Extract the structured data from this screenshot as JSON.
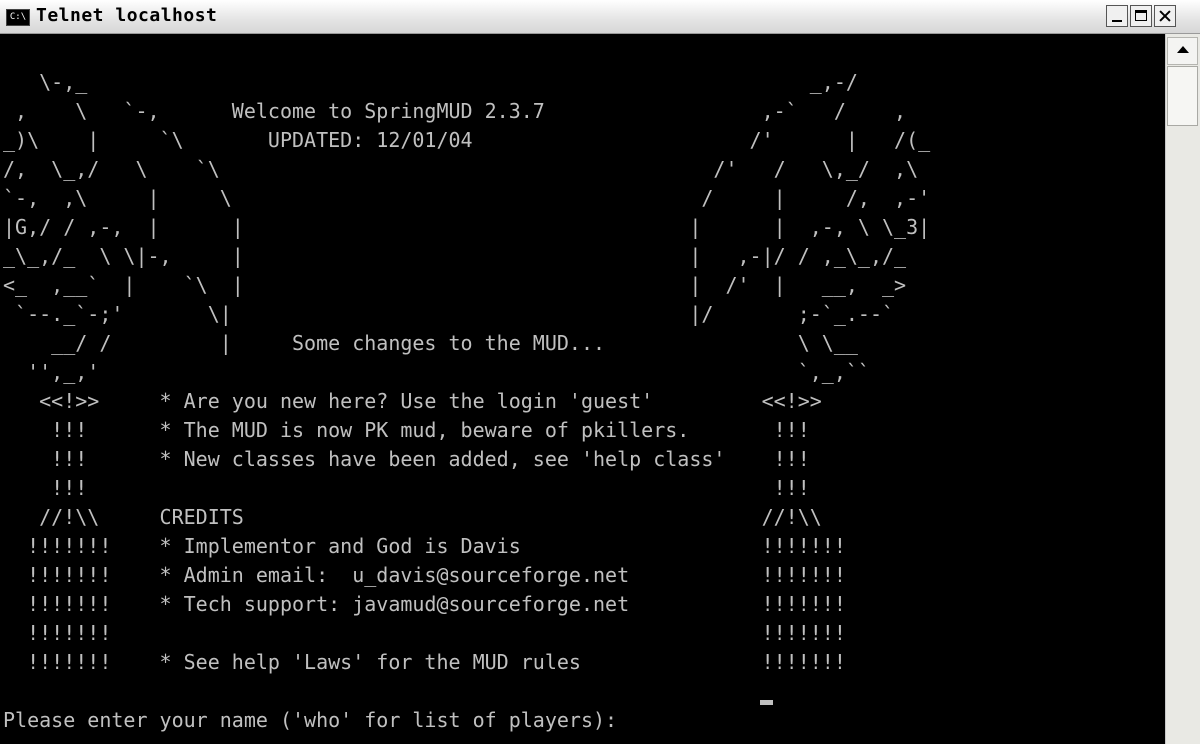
{
  "window": {
    "icon_text": "C:\\",
    "title": "Telnet localhost"
  },
  "console": {
    "lines": [
      "   \\-,_                                                            _,-/",
      " ,    \\   `-,      Welcome to SpringMUD 2.3.7                  ,-`   /    ,",
      "_)\\    |     `\\       UPDATED: 12/01/04                       /'      |   /(_",
      "/,  \\_,/   \\    `\\                                         /'   /   \\,_/  ,\\",
      "`-,  ,\\     |     \\                                       /     |     /,  ,-'",
      "|G,/ / ,-,  |      |                                     |      |  ,-, \\ \\_3|",
      "_\\_,/_  \\ \\|-,     |                                     |   ,-|/ / ,_\\_,/_",
      "<_  ,__`  |    `\\  |                                     |  /'  |   __,  _>",
      " `--._`-;'       \\|                                      |/       ;-`_.--`",
      "    __/ /         |     Some changes to the MUD...                \\ \\__",
      "  '',_,'                                                          `,_,``",
      "   <<!>>     * Are you new here? Use the login 'guest'         <<!>>",
      "    !!!      * The MUD is now PK mud, beware of pkillers.       !!!",
      "    !!!      * New classes have been added, see 'help class'    !!!",
      "    !!!                                                         !!!",
      "   //!\\\\     CREDITS                                           //!\\\\",
      "  !!!!!!!    * Implementor and God is Davis                    !!!!!!!",
      "  !!!!!!!    * Admin email:  u_davis@sourceforge.net           !!!!!!!",
      "  !!!!!!!    * Tech support: javamud@sourceforge.net           !!!!!!!",
      "  !!!!!!!                                                      !!!!!!!",
      "  !!!!!!!    * See help 'Laws' for the MUD rules               !!!!!!!",
      "",
      "Please enter your name ('who' for list of players): "
    ]
  }
}
